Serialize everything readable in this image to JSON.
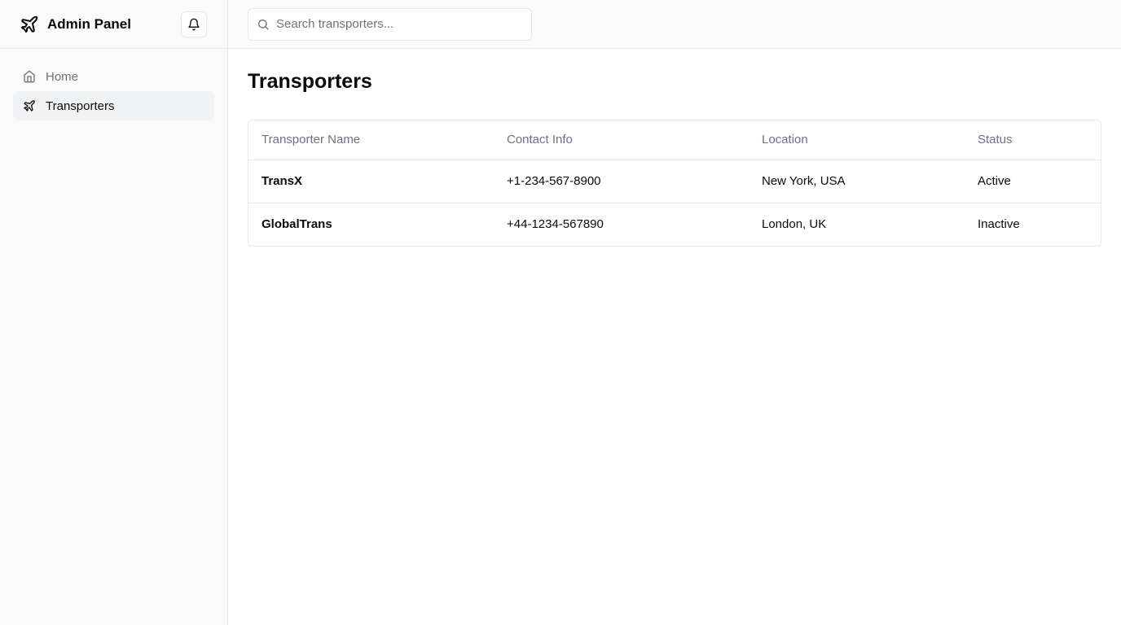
{
  "app": {
    "title": "Admin Panel",
    "brand_icon": "plane-icon"
  },
  "sidebar": {
    "notification_icon": "bell-icon",
    "items": [
      {
        "label": "Home",
        "icon": "home-icon",
        "active": false
      },
      {
        "label": "Transporters",
        "icon": "plane-icon",
        "active": true
      }
    ]
  },
  "search": {
    "placeholder": "Search transporters...",
    "value": ""
  },
  "page": {
    "title": "Transporters"
  },
  "table": {
    "columns": [
      "Transporter Name",
      "Contact Info",
      "Location",
      "Status"
    ],
    "rows": [
      {
        "name": "TransX",
        "contact": "+1-234-567-8900",
        "location": "New York, USA",
        "status": "Active"
      },
      {
        "name": "GlobalTrans",
        "contact": "+44-1234-567890",
        "location": "London, UK",
        "status": "Inactive"
      }
    ]
  },
  "colors": {
    "accent": "#0a0a0a",
    "muted": "#6b7280",
    "border": "#e5e7eb",
    "sidebar_bg": "#fafafa",
    "active_bg": "#f1f2f4"
  }
}
